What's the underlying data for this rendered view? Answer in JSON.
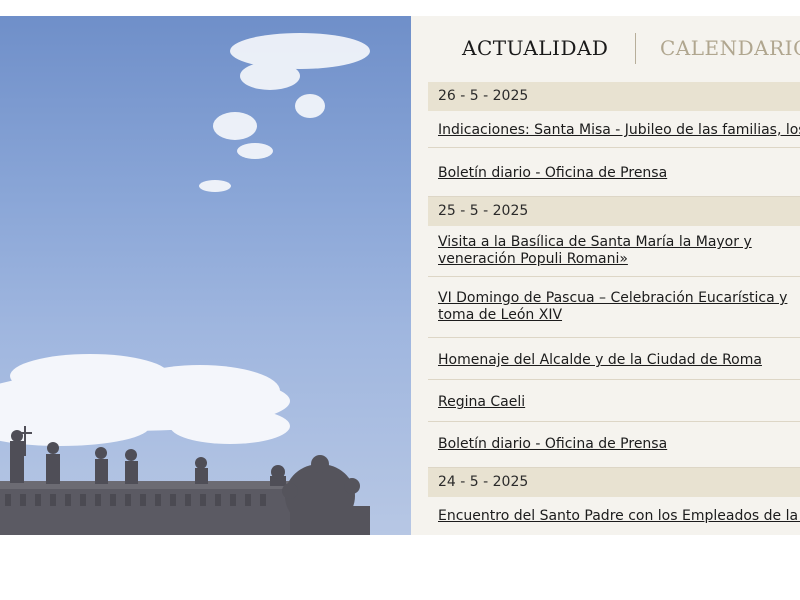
{
  "hero": {
    "image": "st-peters-square-statues-sky",
    "sky_color": "#8aa6d7"
  },
  "tabs": {
    "active": "ACTUALIDAD",
    "inactive": "CALENDARIO"
  },
  "feed": {
    "groups": [
      {
        "date": "26 - 5 - 2025",
        "items": [
          "Indicaciones: Santa Misa - Jubileo de las familias, los niños",
          "Boletín diario - Oficina de Prensa"
        ]
      },
      {
        "date": "25 - 5 - 2025",
        "items": [
          "Visita a la Basílica de Santa María la Mayor y veneración Populi Romani»",
          "VI Domingo de Pascua – Celebración Eucarística y toma de León XIV",
          "Homenaje del Alcalde y de la Ciudad de Roma",
          "Regina Caeli",
          "Boletín diario - Oficina de Prensa"
        ]
      },
      {
        "date": "24 - 5 - 2025",
        "items": [
          "Encuentro del Santo Padre con los Empleados de la S"
        ]
      }
    ]
  },
  "colors": {
    "panel_bg": "#f5f3ee",
    "date_bar": "#e8e2d1",
    "inactive_tab": "#b0a68f"
  }
}
